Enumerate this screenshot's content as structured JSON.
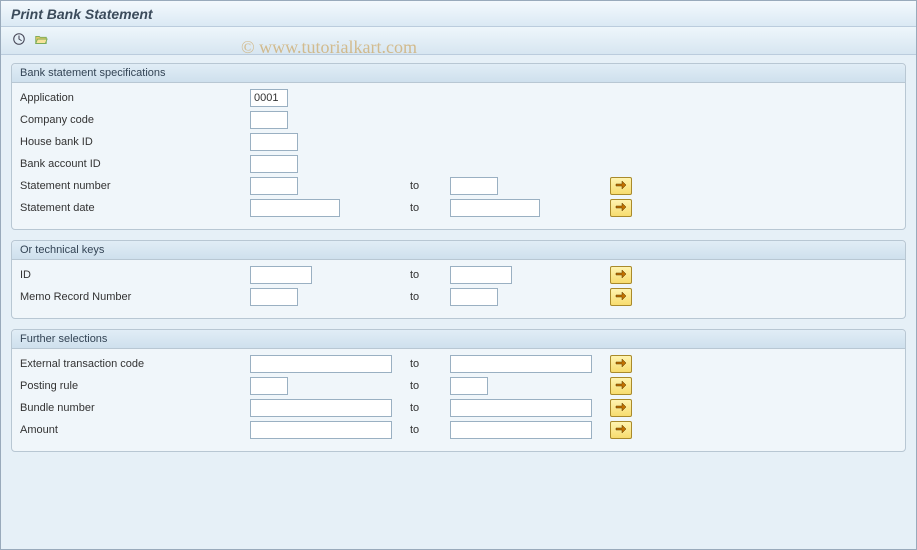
{
  "title": "Print Bank Statement",
  "watermark": "© www.tutorialkart.com",
  "toolbar": {
    "execute_icon": "execute",
    "variant_icon": "variant"
  },
  "to_label": "to",
  "groups": {
    "spec": {
      "title": "Bank statement specifications",
      "application": {
        "label": "Application",
        "value": "0001"
      },
      "company_code": {
        "label": "Company code",
        "value": ""
      },
      "house_bank": {
        "label": "House bank ID",
        "value": ""
      },
      "bank_account": {
        "label": "Bank account ID",
        "value": ""
      },
      "stmt_number": {
        "label": "Statement number",
        "from": "",
        "to": ""
      },
      "stmt_date": {
        "label": "Statement date",
        "from": "",
        "to": ""
      }
    },
    "tech": {
      "title": "Or technical keys",
      "id": {
        "label": "ID",
        "from": "",
        "to": ""
      },
      "memo": {
        "label": "Memo Record Number",
        "from": "",
        "to": ""
      }
    },
    "further": {
      "title": "Further selections",
      "ext_tx": {
        "label": "External transaction code",
        "from": "",
        "to": ""
      },
      "posting": {
        "label": "Posting rule",
        "from": "",
        "to": ""
      },
      "bundle": {
        "label": "Bundle number",
        "from": "",
        "to": ""
      },
      "amount": {
        "label": "Amount",
        "from": "",
        "to": ""
      }
    }
  }
}
